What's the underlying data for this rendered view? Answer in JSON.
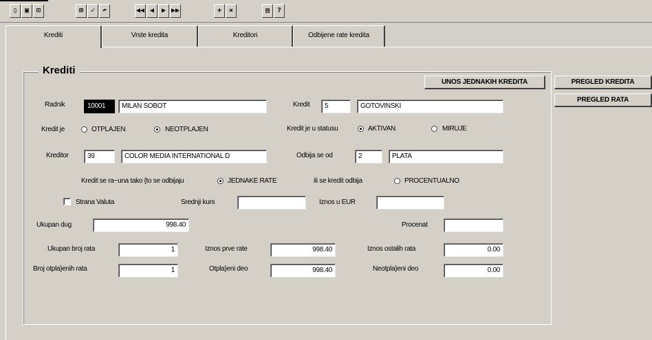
{
  "toolbar": {
    "buttons": [
      {
        "name": "exit-icon",
        "glyph": "▯"
      },
      {
        "name": "save-icon",
        "glyph": "▣"
      },
      {
        "name": "print-icon",
        "glyph": "⊡"
      },
      {
        "name": "query-icon",
        "glyph": "⊠"
      },
      {
        "name": "checkmark-icon",
        "glyph": "✓"
      },
      {
        "name": "undo-icon",
        "glyph": "↶"
      },
      {
        "name": "first-record-icon",
        "glyph": "◀◀"
      },
      {
        "name": "previous-record-icon",
        "glyph": "◀"
      },
      {
        "name": "next-record-icon",
        "glyph": "▶"
      },
      {
        "name": "last-record-icon",
        "glyph": "▶▶"
      },
      {
        "name": "insert-record-icon",
        "glyph": "+"
      },
      {
        "name": "delete-record-icon",
        "glyph": "×"
      },
      {
        "name": "list-icon",
        "glyph": "▤"
      },
      {
        "name": "help-icon",
        "glyph": "?"
      }
    ]
  },
  "tabs": [
    "Krediti",
    "Vrste kredita",
    "Kreditori",
    "Odbijene rate kredita"
  ],
  "group_title": "Krediti",
  "buttons": {
    "unos": "UNOS JEDNAKIH KREDITA",
    "pregled_kredita": "PREGLED KREDITA",
    "pregled_rata": "PREGLED RATA"
  },
  "radnik": {
    "label": "Radnik",
    "id": "10001",
    "name": "MILAN SOBOT"
  },
  "kredit": {
    "label": "Kredit",
    "id": "5",
    "name": "GOTOVINSKI"
  },
  "kredit_je": {
    "label": "Kredit je",
    "opt1": "OTPLAJEN",
    "opt2": "NEOTPLAJEN",
    "selected": "NEOTPLAJEN"
  },
  "status": {
    "label": "Kredit je u statusu",
    "opt1": "AKTIVAN",
    "opt2": "MIRUJE",
    "selected": "AKTIVAN"
  },
  "kreditor": {
    "label": "Kreditor",
    "id": "39",
    "name": "COLOR MEDIA INTERNATIONAL D"
  },
  "odbija": {
    "label": "Odbija se od",
    "id": "2",
    "name": "PLATA"
  },
  "racuna": {
    "label": "Kredit se ra~una tako {to se odbijaju",
    "opt1": "JEDNAKE RATE",
    "label2": "ili se kredit odbija",
    "opt2": "PROCENTUALNO",
    "selected": "JEDNAKE RATE"
  },
  "valuta": {
    "label": "Strana Valuta",
    "checked": false,
    "srednji_label": "Srednji kurs",
    "srednji_value": "",
    "iznos_eur_label": "Iznos u EUR",
    "iznos_eur_value": ""
  },
  "ukupan_dug": {
    "label": "Ukupan dug",
    "value": "998.40"
  },
  "procenat": {
    "label": "Procenat",
    "value": ""
  },
  "ukupan_broj_rata": {
    "label": "Ukupan broj rata",
    "value": "1"
  },
  "iznos_prve_rate": {
    "label": "Iznos prve rate",
    "value": "998.40"
  },
  "iznos_ostalih_rata": {
    "label": "Iznos ostalih rata",
    "value": "0.00"
  },
  "broj_otplacenih": {
    "label": "Broj otpla}enih rata",
    "value": "1"
  },
  "otplaceni_deo": {
    "label": "Otpla}eni deo",
    "value": "998.40"
  },
  "neotplaceni_deo": {
    "label": "Neotpla}eni deo",
    "value": "0.00"
  }
}
